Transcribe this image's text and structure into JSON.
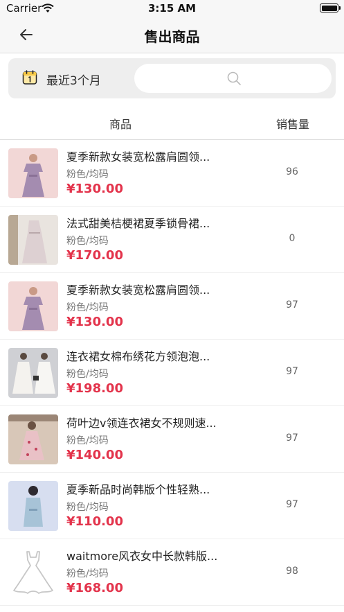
{
  "status_bar": {
    "carrier": "Carrier",
    "time": "3:15 AM"
  },
  "nav": {
    "title": "售出商品",
    "back_icon": "arrow-left-icon"
  },
  "filter": {
    "period_label": "最近3个月",
    "calendar_icon": "calendar-icon",
    "search_placeholder": "",
    "search_icon": "search-icon"
  },
  "table": {
    "col_goods": "商品",
    "col_sales": "销售量"
  },
  "products": [
    {
      "title": "夏季新款女装宽松露肩圆领...",
      "spec": "粉色/均码",
      "price": "¥130.00",
      "sales": "96"
    },
    {
      "title": "法式甜美桔梗裙夏季锁骨裙...",
      "spec": "粉色/均码",
      "price": "¥170.00",
      "sales": "0"
    },
    {
      "title": "夏季新款女装宽松露肩圆领...",
      "spec": "粉色/均码",
      "price": "¥130.00",
      "sales": "97"
    },
    {
      "title": "连衣裙女棉布绣花方领泡泡...",
      "spec": "粉色/均码",
      "price": "¥198.00",
      "sales": "97"
    },
    {
      "title": "荷叶边v领连衣裙女不规则速...",
      "spec": "粉色/均码",
      "price": "¥140.00",
      "sales": "97"
    },
    {
      "title": "夏季新品时尚韩版个性轻熟...",
      "spec": "粉色/均码",
      "price": "¥110.00",
      "sales": "97"
    },
    {
      "title": "waitmore风衣女中长款韩版...",
      "spec": "粉色/均码",
      "price": "¥168.00",
      "sales": "98"
    }
  ],
  "colors": {
    "price": "#e3334b",
    "nav_bg": "#f7f7f7",
    "filter_bg": "#eeeeee"
  }
}
